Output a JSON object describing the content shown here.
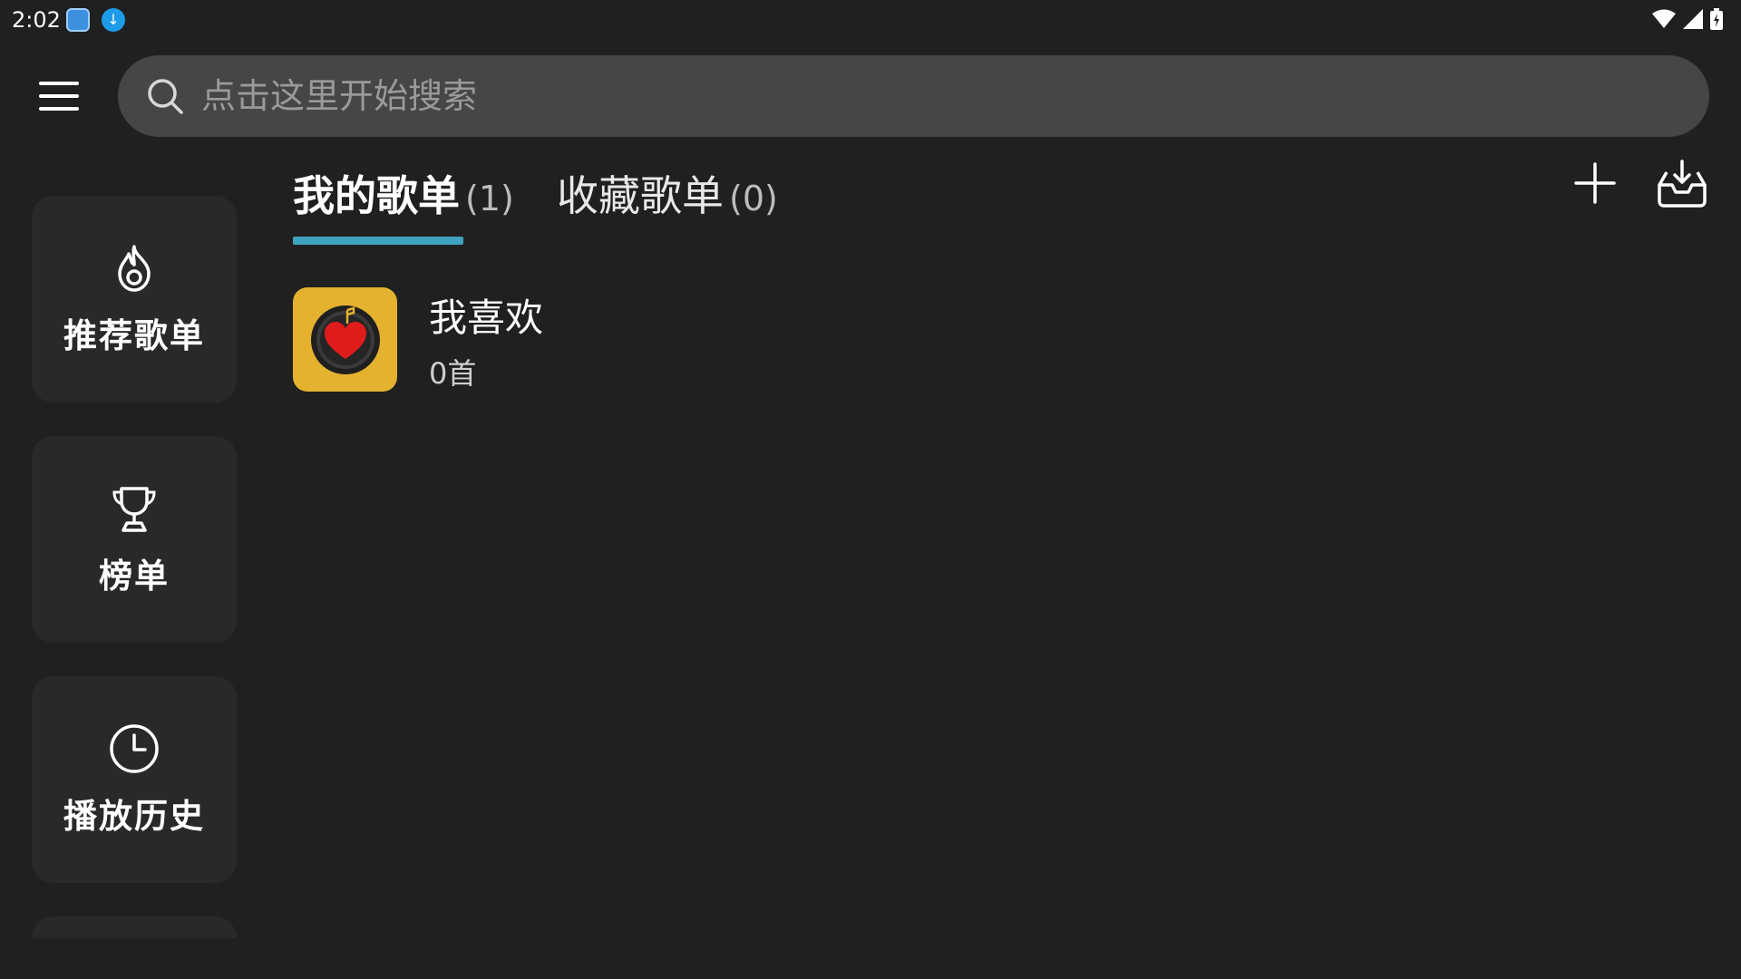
{
  "status_bar": {
    "time": "2:02",
    "icons": [
      "gallery-app-icon",
      "download-app-icon",
      "wifi-icon",
      "cell-signal-icon",
      "battery-icon"
    ]
  },
  "search": {
    "placeholder": "点击这里开始搜索"
  },
  "nav": {
    "items": [
      {
        "label": "推荐歌单",
        "icon": "fire-icon"
      },
      {
        "label": "榜单",
        "icon": "trophy-icon"
      },
      {
        "label": "播放历史",
        "icon": "clock-icon"
      }
    ]
  },
  "tabs": [
    {
      "label": "我的歌单",
      "count": "(1)",
      "active": true
    },
    {
      "label": "收藏歌单",
      "count": "(0)",
      "active": false
    }
  ],
  "actions": {
    "add_icon": "plus-icon",
    "import_icon": "inbox-download-icon"
  },
  "playlists": [
    {
      "title": "我喜欢",
      "count": "0首",
      "cover_icon": "heart-record-icon"
    }
  ],
  "colors": {
    "background": "#202020",
    "card": "#292929",
    "search_bg": "#464646",
    "accent": "#3fa3bf",
    "cover_bg": "#e5b22f",
    "heart": "#e01b1b"
  }
}
